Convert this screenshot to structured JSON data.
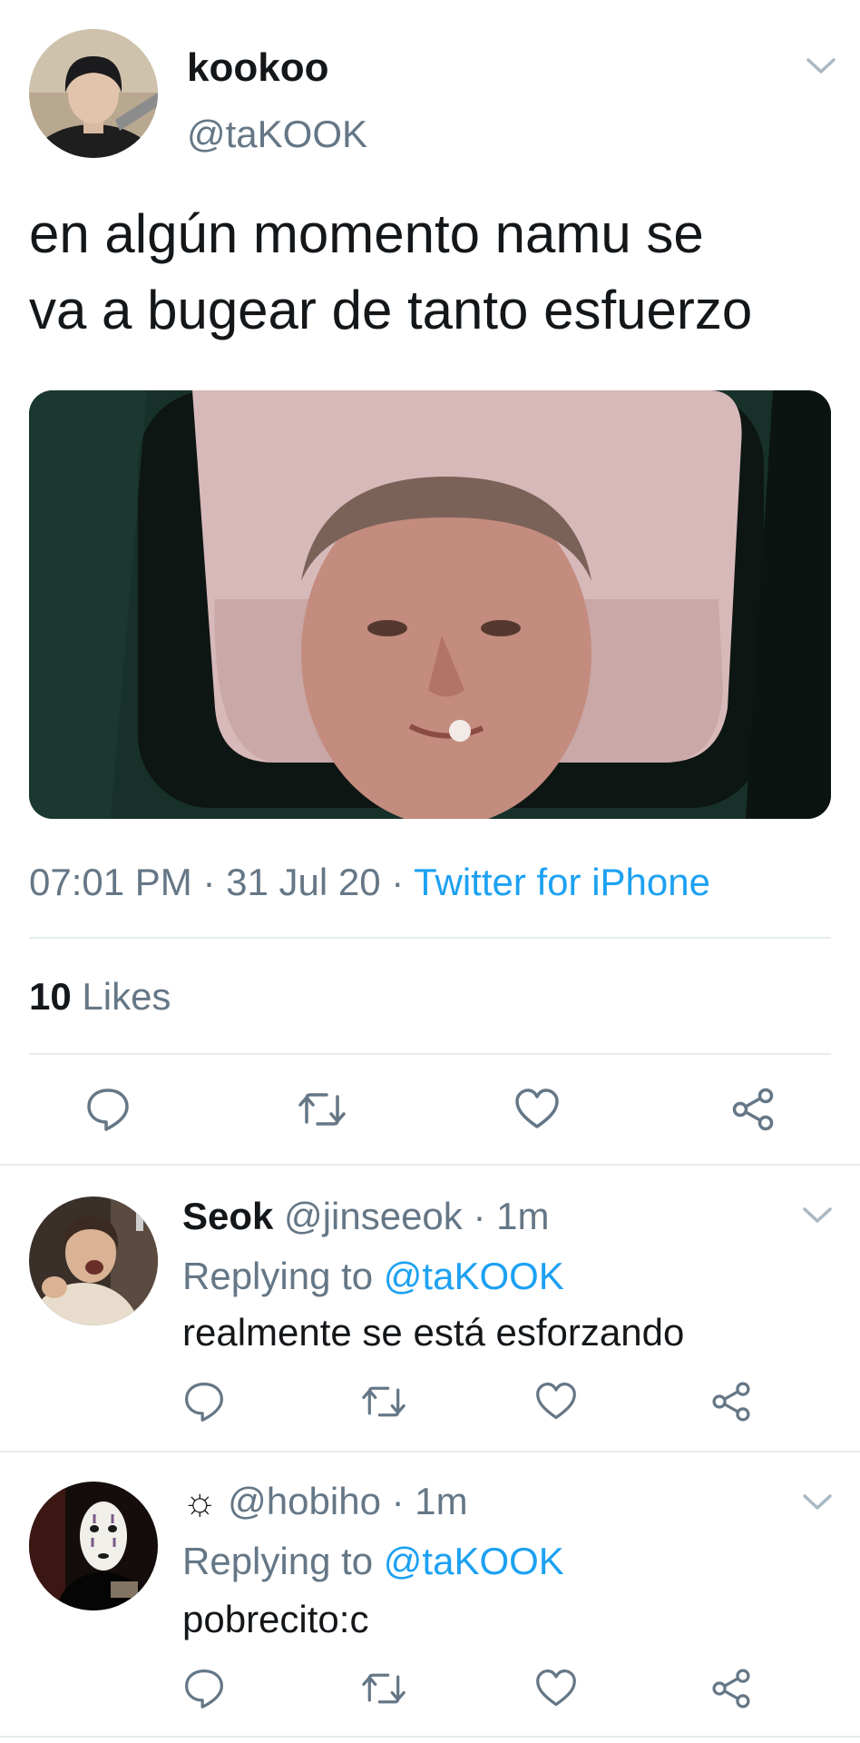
{
  "tweet": {
    "author_name": "kookoo",
    "author_handle": "@taKOOK",
    "text_line1": "en algún momento namu se",
    "text_line2": "va a bugear de tanto esfuerzo",
    "time": "07:01 PM",
    "separator": " · ",
    "date": "31 Jul 20",
    "source": "Twitter for iPhone",
    "likes_count": "10",
    "likes_label": " Likes"
  },
  "replies": [
    {
      "name": "Seok",
      "handle": " @jinseeok",
      "time": " · 1m",
      "replying_prefix": "Replying to ",
      "replying_to": "@taKOOK",
      "text": "realmente se está esforzando"
    },
    {
      "name": "☼",
      "handle": " @hobiho",
      "time": " · 1m",
      "replying_prefix": "Replying to ",
      "replying_to": "@taKOOK",
      "text": "pobrecito:c"
    }
  ],
  "icons": [
    "chevron-down-icon",
    "reply-icon",
    "retweet-icon",
    "like-icon",
    "share-icon"
  ],
  "colors": {
    "accent": "#1da1f2",
    "secondary_text": "#657786",
    "primary_text": "#14171a",
    "divider": "#e6ecf0"
  }
}
